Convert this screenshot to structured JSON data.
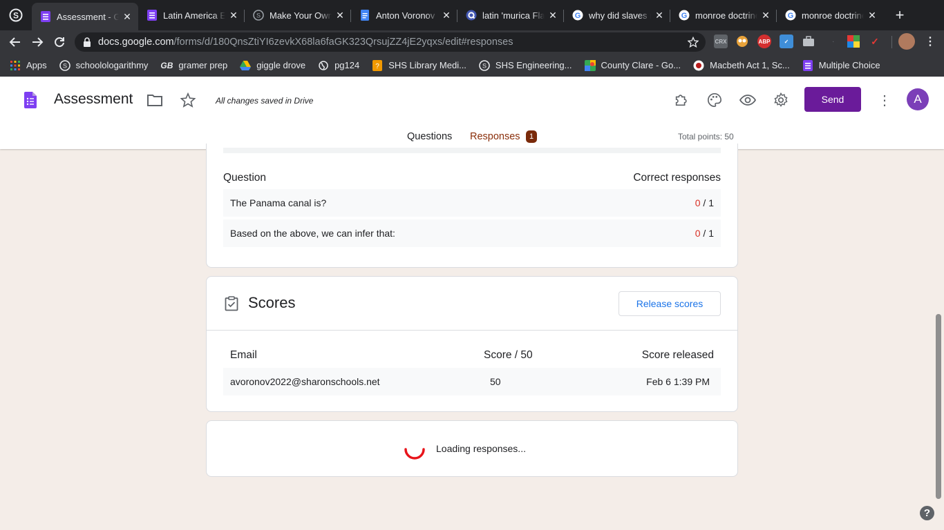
{
  "browser": {
    "tabs": [
      {
        "title": "Assessment - G",
        "active": true
      },
      {
        "title": "Latin America E"
      },
      {
        "title": "Make Your Own"
      },
      {
        "title": "Anton Voronov -"
      },
      {
        "title": "latin 'murica Fla"
      },
      {
        "title": "why did slaves r"
      },
      {
        "title": "monroe doctrine"
      },
      {
        "title": "monroe doctrine"
      }
    ],
    "url_host": "docs.google.com",
    "url_path": "/forms/d/180QnsZtiYI6zevkX68la6faGK323QrsujZZ4jE2yqxs/edit#responses",
    "extensions": [
      "CRX",
      "ABP"
    ],
    "bookmarks": [
      {
        "label": "Apps",
        "icon": "apps-grid-icon"
      },
      {
        "label": "schoolologarithmy",
        "icon": "schoology-icon"
      },
      {
        "label": "gramer prep",
        "icon": "gb-icon"
      },
      {
        "label": "giggle drove",
        "icon": "drive-icon"
      },
      {
        "label": "pg124",
        "icon": "globe-icon"
      },
      {
        "label": "SHS Library Medi...",
        "icon": "library-icon"
      },
      {
        "label": "SHS Engineering...",
        "icon": "schoology-icon"
      },
      {
        "label": "County Clare - Go...",
        "icon": "maps-icon"
      },
      {
        "label": "Macbeth Act 1, Sc...",
        "icon": "macbeth-icon"
      },
      {
        "label": "Multiple Choice",
        "icon": "forms-icon"
      }
    ]
  },
  "form": {
    "title": "Assessment",
    "saved_status": "All changes saved in Drive",
    "send_label": "Send",
    "avatar_letter": "A",
    "tabs": {
      "questions": "Questions",
      "responses": "Responses",
      "responses_count": "1"
    },
    "total_points": "Total points: 50"
  },
  "questions_card": {
    "col_question": "Question",
    "col_correct": "Correct responses",
    "rows": [
      {
        "question": "The Panama canal is?",
        "correct": "0",
        "total": "/ 1"
      },
      {
        "question": "Based on the above, we can infer that:",
        "correct": "0",
        "total": "/ 1"
      }
    ]
  },
  "scores_card": {
    "title": "Scores",
    "release_label": "Release scores",
    "col_email": "Email",
    "col_score": "Score / 50",
    "col_released": "Score released",
    "rows": [
      {
        "email": "avoronov2022@sharonschools.net",
        "score": "50",
        "released": "Feb 6 1:39 PM"
      }
    ]
  },
  "loading_card": {
    "text": "Loading responses..."
  },
  "colors": {
    "accent_purple": "#6a1b9a",
    "responses_tab": "#8a2e0a",
    "error_red": "#d93025",
    "link_blue": "#1a73e8",
    "page_bg": "#f4ede8"
  },
  "help_label": "?"
}
